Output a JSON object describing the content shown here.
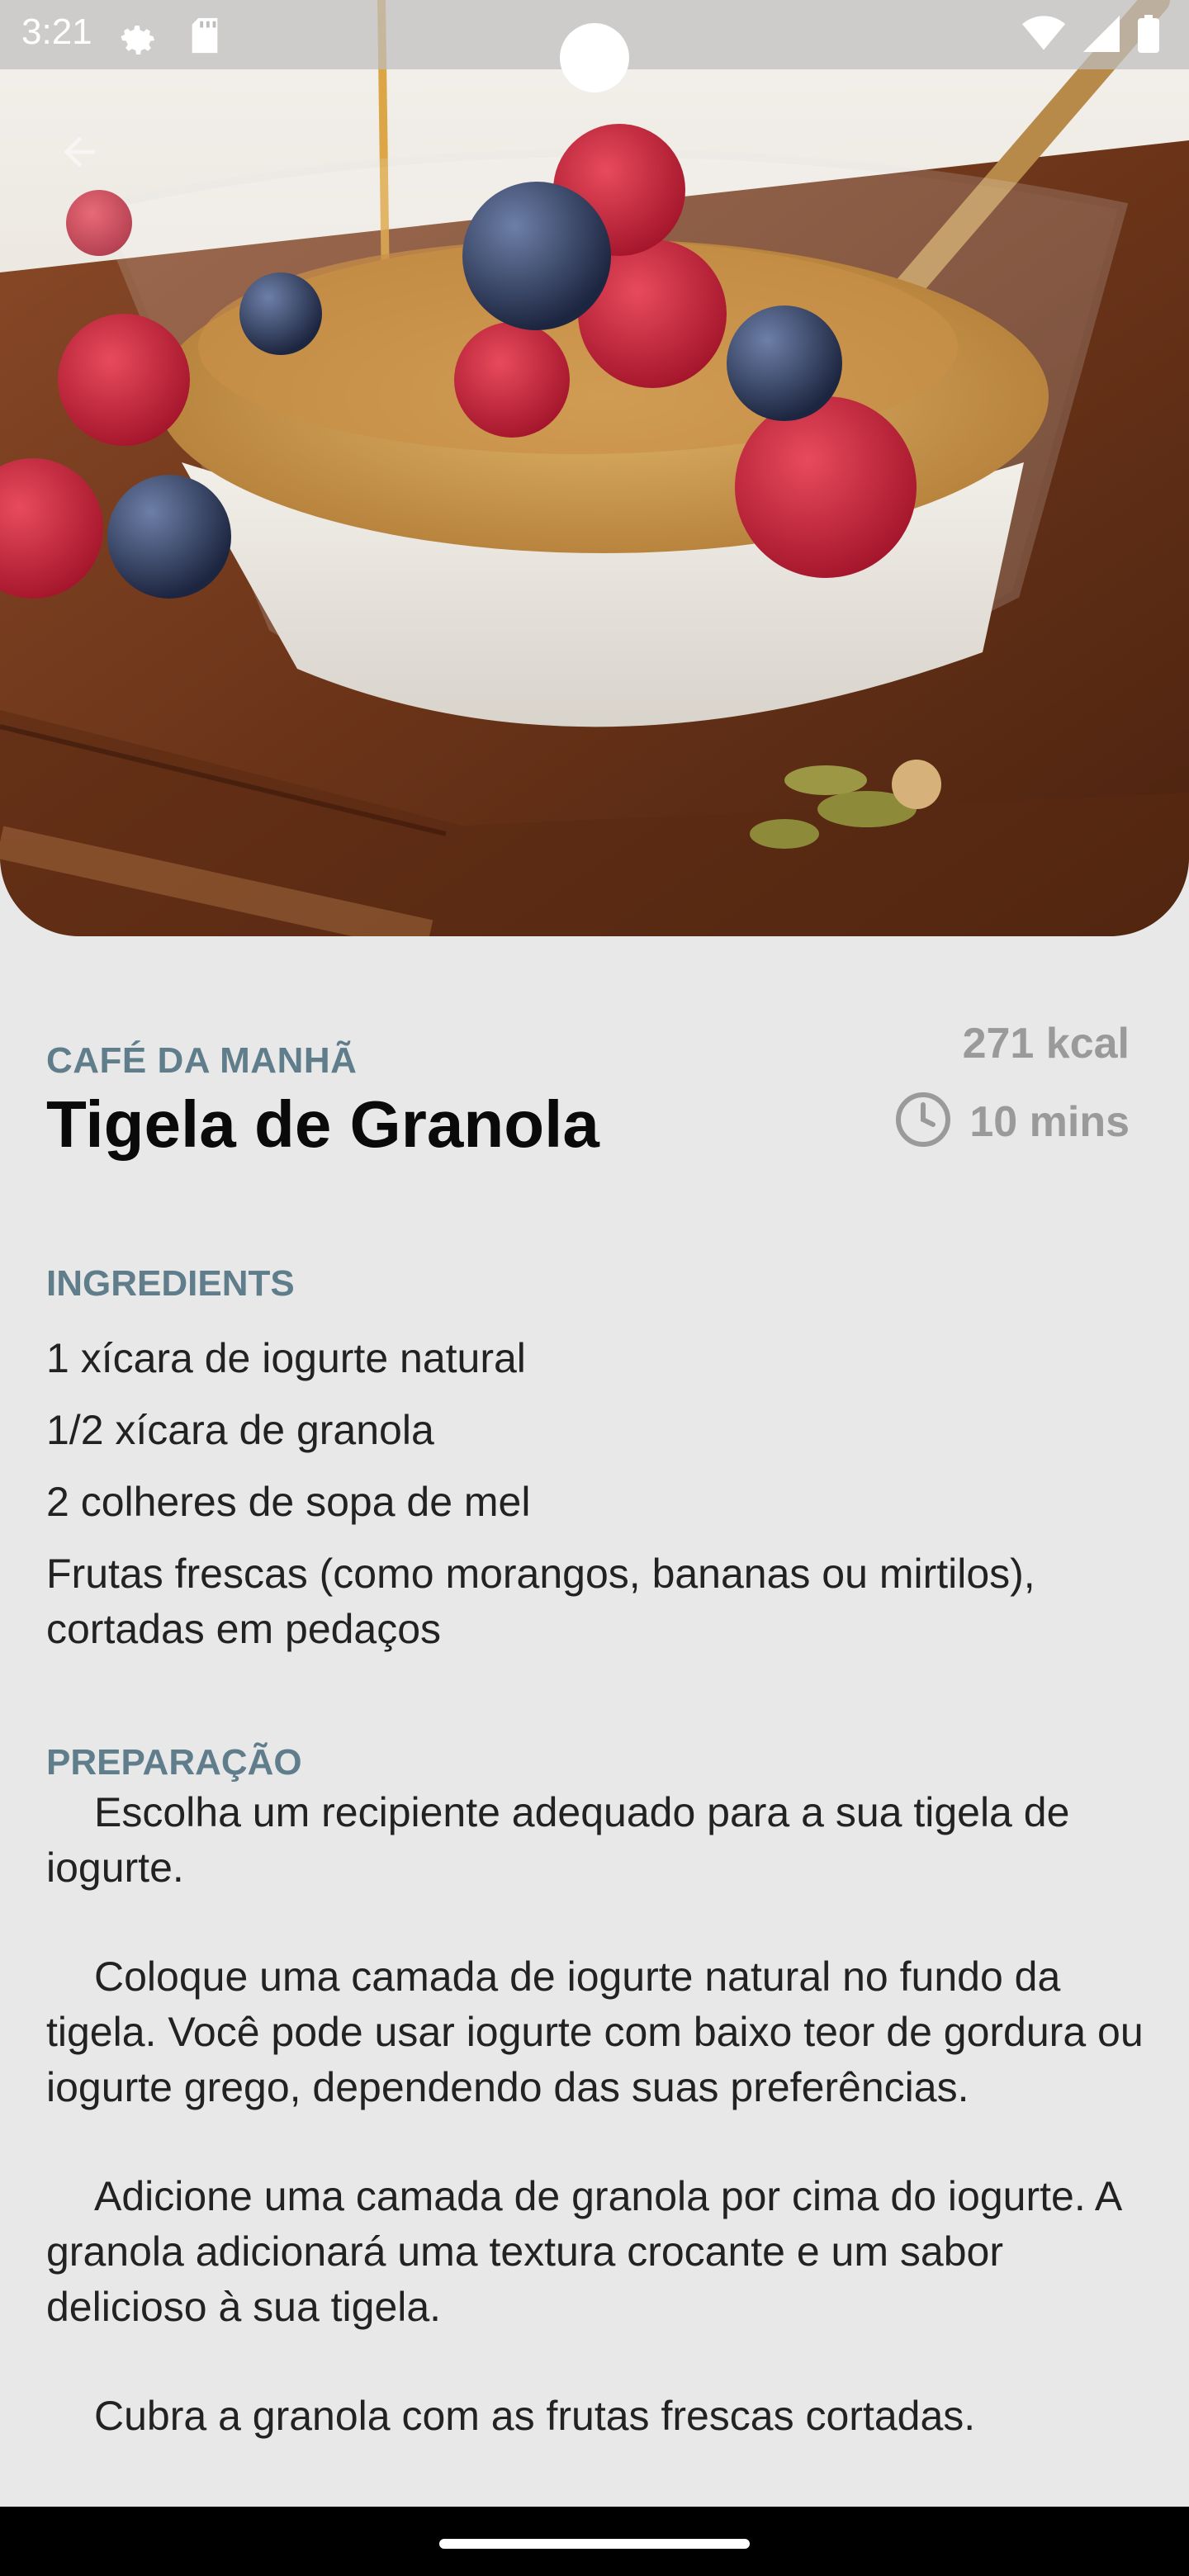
{
  "status_bar": {
    "time": "3:21"
  },
  "recipe": {
    "category": "CAFÉ DA MANHÃ",
    "title": "Tigela de Granola",
    "calories": "271 kcal",
    "duration": "10 mins"
  },
  "ingredients": {
    "heading": "INGREDIENTS",
    "items": [
      "1 xícara de iogurte natural",
      "1/2 xícara de granola",
      "2 colheres de sopa de mel",
      "Frutas frescas (como morangos, bananas ou mirtilos), cortadas em pedaços"
    ]
  },
  "preparation": {
    "heading": "PREPARAÇÃO",
    "steps": [
      "Escolha um recipiente adequado para a sua tigela de iogurte.",
      "Coloque uma camada de iogurte natural no fundo da tigela. Você pode usar iogurte com baixo teor de gordura ou iogurte grego, dependendo das suas preferências.",
      "Adicione uma camada de granola por cima do iogurte. A granola adicionará uma textura crocante e um sabor delicioso à sua tigela.",
      "Cubra a granola com as frutas frescas cortadas."
    ]
  },
  "colors": {
    "section_heading": "#607d8b",
    "muted_meta": "#9a9a9a",
    "background": "#e8e8e8"
  },
  "icons": [
    "settings-gear-icon",
    "sd-card-icon",
    "wifi-icon",
    "cellular-signal-icon",
    "battery-icon",
    "back-arrow-icon",
    "clock-icon"
  ]
}
